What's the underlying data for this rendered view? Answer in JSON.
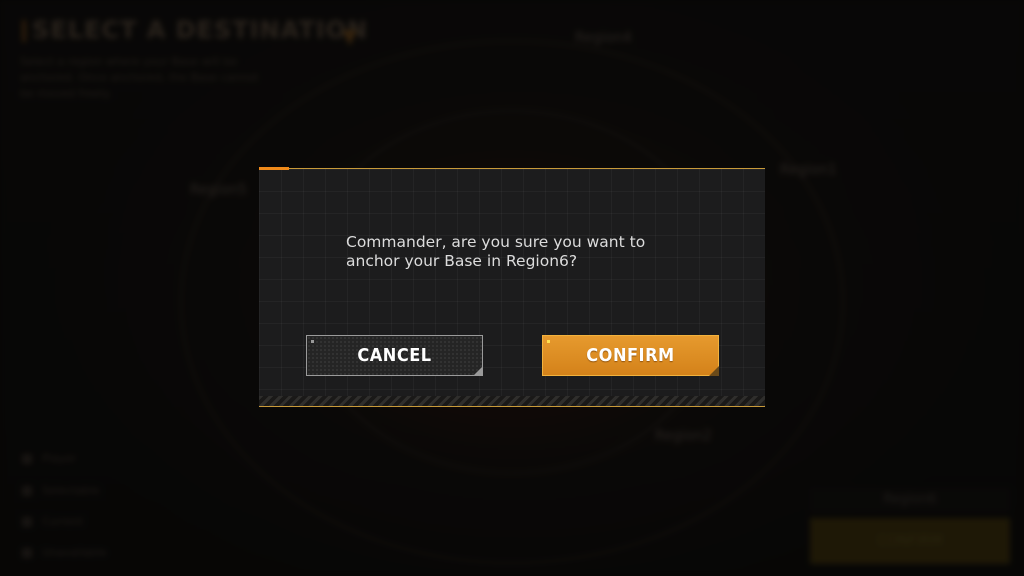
{
  "background": {
    "title": "SELECT A DESTINATION",
    "description": "Select a region where your Base will be anchored. Once anchored, the Base cannot be moved freely.",
    "regions": [
      "Region1",
      "Region2",
      "Region3",
      "Region4",
      "Region5",
      "Region6"
    ],
    "legend": [
      "Player",
      "Selectable",
      "Current",
      "Unavailable"
    ],
    "selected_region_label": "Region6",
    "confirm_label": "CONFIRM"
  },
  "dialog": {
    "message_line1": "Commander, are you sure you want to",
    "message_line2": "anchor your Base in Region6?",
    "cancel_label": "CANCEL",
    "confirm_label": "CONFIRM"
  },
  "colors": {
    "accent": "#f08a1a",
    "confirm_button": "#e0922a",
    "dialog_border": "#c89a3a",
    "dialog_bg": "#1c1c1d"
  }
}
